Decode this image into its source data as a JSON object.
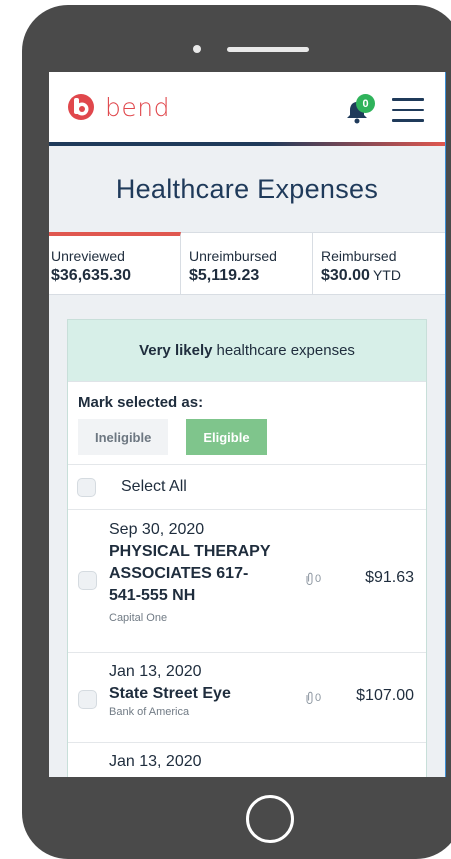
{
  "header": {
    "brand": "bend",
    "notification_count": "0",
    "icons": {
      "logo": "bend-logo-icon",
      "notifications": "bell-icon",
      "menu": "hamburger-menu-icon"
    },
    "colors": {
      "brand": "#e0474c",
      "navy": "#1f3a5a",
      "badge": "#2fb35b"
    }
  },
  "page": {
    "title": "Healthcare Expenses"
  },
  "tabs": [
    {
      "label": "Unreviewed",
      "amount": "$36,635.30",
      "suffix": "",
      "active": true
    },
    {
      "label": "Unreimbursed",
      "amount": "$5,119.23",
      "suffix": "",
      "active": false
    },
    {
      "label": "Reimbursed",
      "amount": "$30.00",
      "suffix": "YTD",
      "active": false
    }
  ],
  "card": {
    "title_bold": "Very likely",
    "title_rest": "healthcare expenses",
    "mark_label": "Mark selected as:",
    "ineligible_label": "Ineligible",
    "eligible_label": "Eligible",
    "select_all_label": "Select All",
    "colors": {
      "header_bg": "#d7efe8",
      "eligible": "#7fc58c"
    }
  },
  "transactions": [
    {
      "date": "Sep 30, 2020",
      "name_lines": [
        "PHYSICAL THERAPY",
        "ASSOCIATES 617-",
        "541-555 NH"
      ],
      "bank": "Capital One",
      "attachments": "0",
      "amount": "$91.63"
    },
    {
      "date": "Jan 13, 2020",
      "name_lines": [
        "State Street Eye"
      ],
      "bank": "Bank of America",
      "attachments": "0",
      "amount": "$107.00"
    },
    {
      "date": "Jan 13, 2020"
    }
  ]
}
